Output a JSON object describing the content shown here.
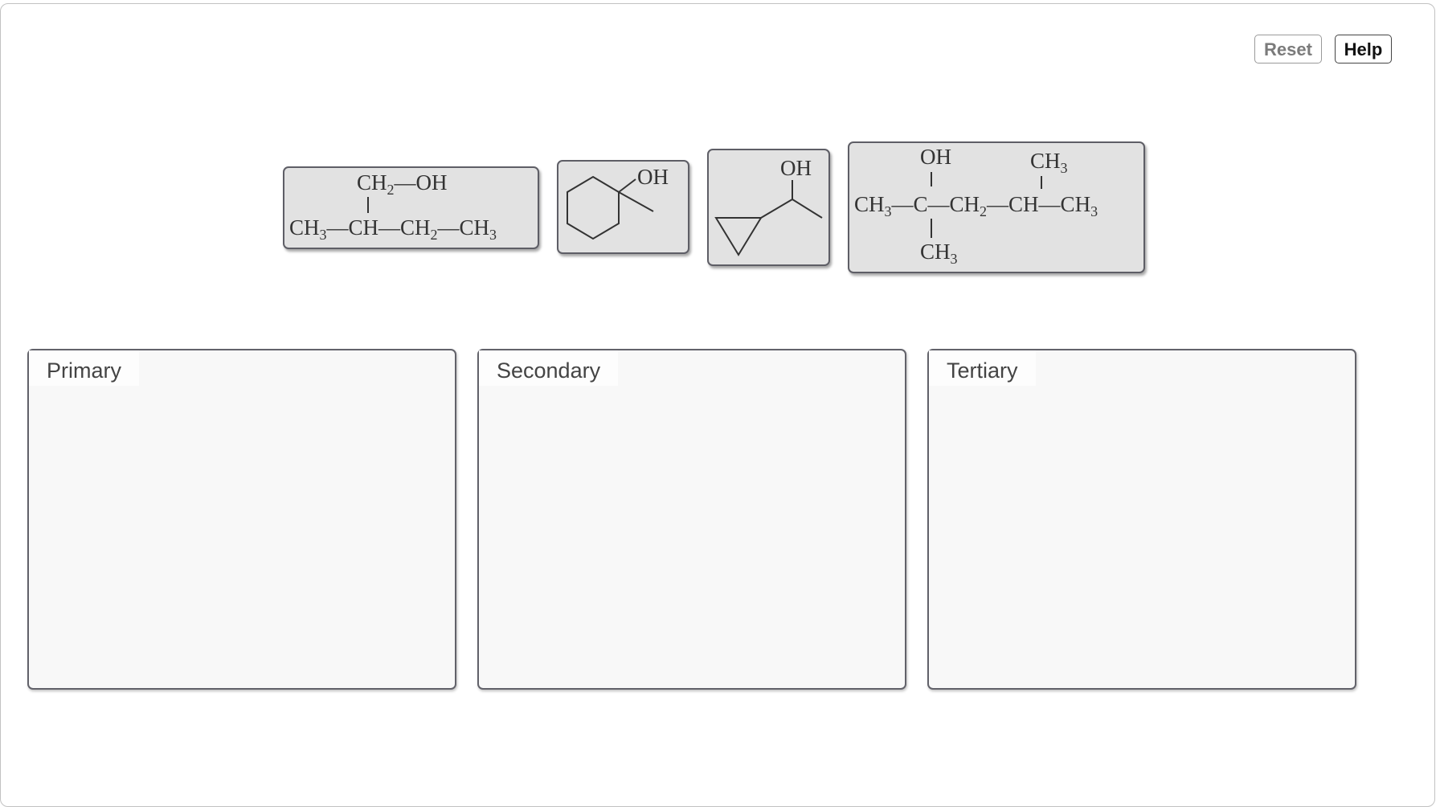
{
  "toolbar": {
    "reset_label": "Reset",
    "help_label": "Help"
  },
  "molecules": [
    {
      "id": "mol-2-methylbutanol",
      "top_line": [
        "CH",
        "2",
        "—OH"
      ],
      "main_line": [
        "CH",
        "3",
        "—CH—CH",
        "2",
        "—CH",
        "3"
      ]
    },
    {
      "id": "mol-methylcyclohexanol",
      "label": "OH"
    },
    {
      "id": "mol-cyclopropylethanol",
      "label": "OH"
    },
    {
      "id": "mol-dimethylpentanol",
      "top_left": "OH",
      "top_right": [
        "CH",
        "3"
      ],
      "main_line": [
        "CH",
        "3",
        "—C—CH",
        "2",
        "—CH—CH",
        "3"
      ],
      "bottom": [
        "CH",
        "3"
      ]
    }
  ],
  "bins": [
    {
      "label": "Primary"
    },
    {
      "label": "Secondary"
    },
    {
      "label": "Tertiary"
    }
  ]
}
